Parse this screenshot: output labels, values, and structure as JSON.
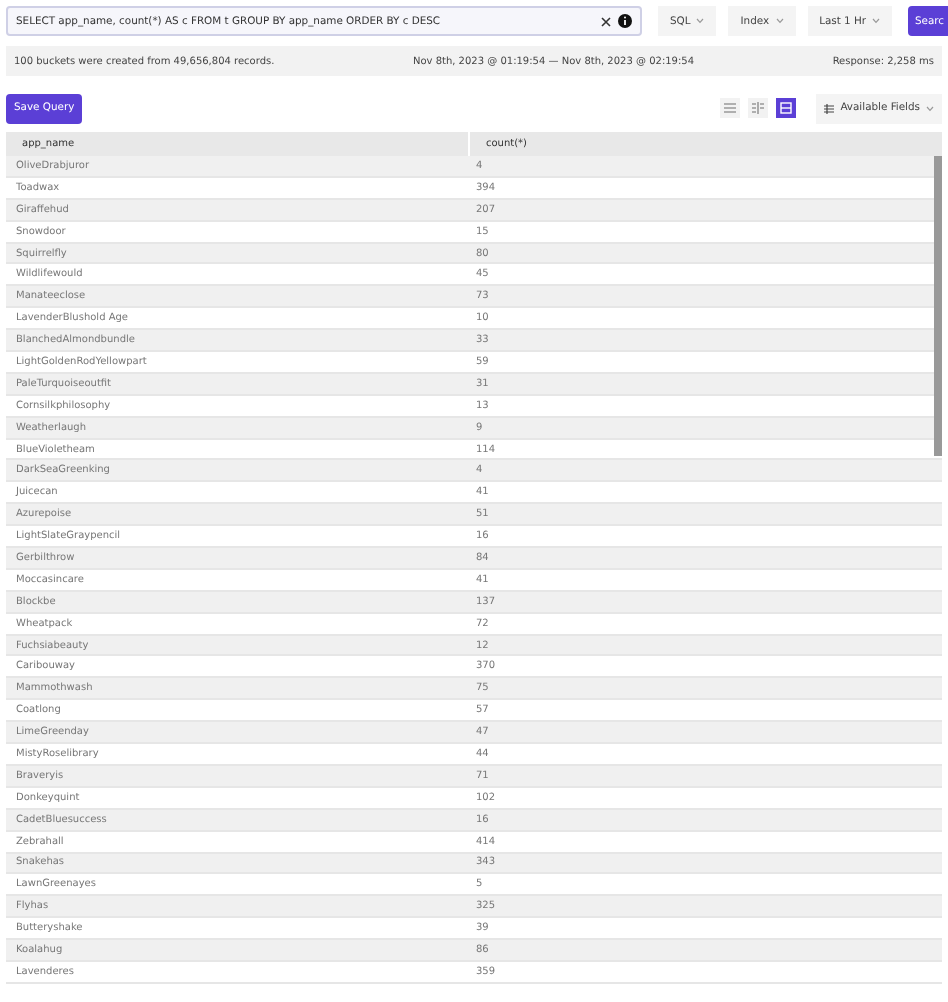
{
  "query_bar": {
    "query": "SELECT app_name, count(*) AS c FROM t GROUP BY app_name ORDER BY c DESC",
    "mode": "SQL",
    "index": "Index",
    "time_range": "Last 1 Hr",
    "search_button": "Searc"
  },
  "info_bar": {
    "summary": "100 buckets were created from 49,656,804 records.",
    "range": "Nov 8th, 2023 @ 01:19:54 — Nov 8th, 2023 @ 02:19:54",
    "response": "Response: 2,258 ms"
  },
  "toolbar": {
    "save_button": "Save Query",
    "views": [
      {
        "kind": "list",
        "selected": false
      },
      {
        "kind": "split",
        "selected": false
      },
      {
        "kind": "table",
        "selected": true
      }
    ],
    "fields_button": "Available Fields"
  },
  "table": {
    "columns": [
      "app_name",
      "count(*)"
    ],
    "rows": [
      [
        "OliveDrabjuror",
        "4"
      ],
      [
        "Toadwax",
        "394"
      ],
      [
        "Giraffehud",
        "207"
      ],
      [
        "Snowdoor",
        "15"
      ],
      [
        "Squirrelfly",
        "80"
      ],
      [
        "Wildlifewould",
        "45"
      ],
      [
        "Manateeclose",
        "73"
      ],
      [
        "LavenderBlushold Age",
        "10"
      ],
      [
        "BlanchedAlmondbundle",
        "33"
      ],
      [
        "LightGoldenRodYellowpart",
        "59"
      ],
      [
        "PaleTurquoiseoutfit",
        "31"
      ],
      [
        "Cornsilkphilosophy",
        "13"
      ],
      [
        "Weatherlaugh",
        "9"
      ],
      [
        "BlueVioletheam",
        "114"
      ],
      [
        "DarkSeaGreenking",
        "4"
      ],
      [
        "Juicecan",
        "41"
      ],
      [
        "Azurepoise",
        "51"
      ],
      [
        "LightSlateGraypencil",
        "16"
      ],
      [
        "Gerbilthrow",
        "84"
      ],
      [
        "Moccasincare",
        "41"
      ],
      [
        "Blockbe",
        "137"
      ],
      [
        "Wheatpack",
        "72"
      ],
      [
        "Fuchsiabeauty",
        "12"
      ],
      [
        "Caribouway",
        "370"
      ],
      [
        "Mammothwash",
        "75"
      ],
      [
        "Coatlong",
        "57"
      ],
      [
        "LimeGreenday",
        "47"
      ],
      [
        "MistyRoselibrary",
        "44"
      ],
      [
        "Braveryis",
        "71"
      ],
      [
        "Donkeyquint",
        "102"
      ],
      [
        "CadetBluesuccess",
        "16"
      ],
      [
        "Zebrahall",
        "414"
      ],
      [
        "Snakehas",
        "343"
      ],
      [
        "LawnGreenayes",
        "5"
      ],
      [
        "Flyhas",
        "325"
      ],
      [
        "Butteryshake",
        "39"
      ],
      [
        "Koalahug",
        "86"
      ],
      [
        "Lavenderes",
        "359"
      ]
    ]
  }
}
